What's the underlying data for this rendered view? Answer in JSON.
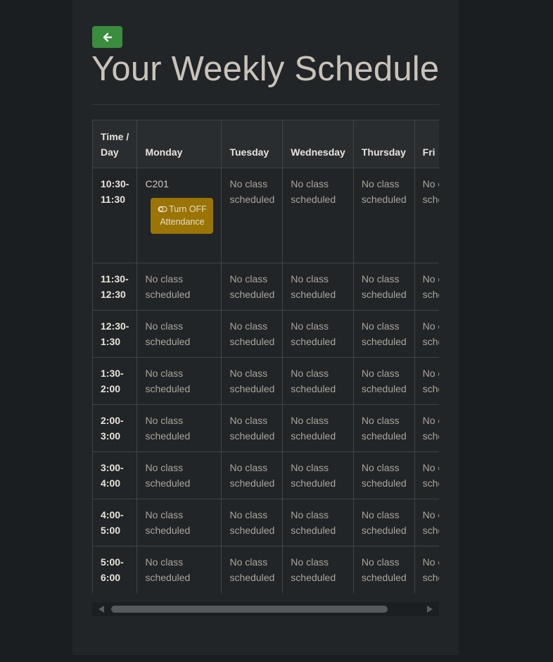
{
  "page": {
    "title": "Your Weekly Schedule",
    "back_icon": "arrow-left-icon",
    "colors": {
      "back_button": "#3a8c3f",
      "attendance_button": "#9a7405",
      "background": "#222527"
    }
  },
  "schedule": {
    "header_time_day": "Time / Day",
    "days": [
      "Monday",
      "Tuesday",
      "Wednesday",
      "Thursday",
      "Fri"
    ],
    "empty_text": "No class scheduled",
    "rows": [
      {
        "time": "10:30-11:30",
        "cells": [
          {
            "class": "C201",
            "button": "Turn OFF Attendance",
            "icon": "toggle-icon"
          },
          {
            "text": "No class scheduled"
          },
          {
            "text": "No class scheduled"
          },
          {
            "text": "No class scheduled"
          },
          {
            "text": "No class scheduled"
          }
        ]
      },
      {
        "time": "11:30-12:30",
        "cells": [
          {
            "text": "No class scheduled"
          },
          {
            "text": "No class scheduled"
          },
          {
            "text": "No class scheduled"
          },
          {
            "text": "No class scheduled"
          },
          {
            "text": "No class scheduled"
          }
        ]
      },
      {
        "time": "12:30-1:30",
        "cells": [
          {
            "text": "No class scheduled"
          },
          {
            "text": "No class scheduled"
          },
          {
            "text": "No class scheduled"
          },
          {
            "text": "No class scheduled"
          },
          {
            "text": "No class scheduled"
          }
        ]
      },
      {
        "time": "1:30-2:00",
        "cells": [
          {
            "text": "No class scheduled"
          },
          {
            "text": "No class scheduled"
          },
          {
            "text": "No class scheduled"
          },
          {
            "text": "No class scheduled"
          },
          {
            "text": "No class scheduled"
          }
        ]
      },
      {
        "time": "2:00-3:00",
        "cells": [
          {
            "text": "No class scheduled"
          },
          {
            "text": "No class scheduled"
          },
          {
            "text": "No class scheduled"
          },
          {
            "text": "No class scheduled"
          },
          {
            "text": "No class scheduled"
          }
        ]
      },
      {
        "time": "3:00-4:00",
        "cells": [
          {
            "text": "No class scheduled"
          },
          {
            "text": "No class scheduled"
          },
          {
            "text": "No class scheduled"
          },
          {
            "text": "No class scheduled"
          },
          {
            "text": "No class scheduled"
          }
        ]
      },
      {
        "time": "4:00-5:00",
        "cells": [
          {
            "text": "No class scheduled"
          },
          {
            "text": "No class scheduled"
          },
          {
            "text": "No class scheduled"
          },
          {
            "text": "No class scheduled"
          },
          {
            "text": "No class scheduled"
          }
        ]
      },
      {
        "time": "5:00-6:00",
        "cells": [
          {
            "text": "No class scheduled"
          },
          {
            "text": "No class scheduled"
          },
          {
            "text": "No class scheduled"
          },
          {
            "text": "No class scheduled"
          },
          {
            "text": "No class scheduled"
          }
        ]
      }
    ]
  },
  "scrollbar": {
    "left_icon": "arrow-left-icon",
    "right_icon": "arrow-right-icon"
  }
}
